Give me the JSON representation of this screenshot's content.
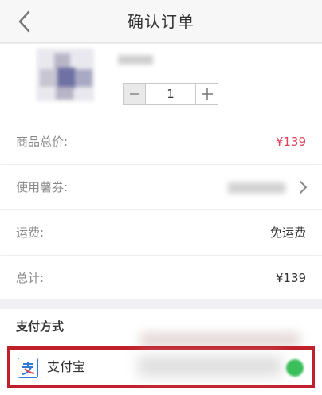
{
  "header": {
    "title": "确认订单",
    "back_icon": "chevron-left-icon"
  },
  "product": {
    "quantity": "1"
  },
  "rows": [
    {
      "label": "商品总价:",
      "value": "¥139",
      "value_color": "#e0425a"
    },
    {
      "label": "使用薯券:",
      "value": ""
    },
    {
      "label": "运费:",
      "value": "免运费"
    },
    {
      "label": "总计:",
      "value": "¥139"
    }
  ],
  "payment": {
    "section_title": "支付方式",
    "option_name": "支付宝",
    "option_icon": "alipay-icon",
    "selected": true,
    "accent_color": "#c0202a"
  }
}
